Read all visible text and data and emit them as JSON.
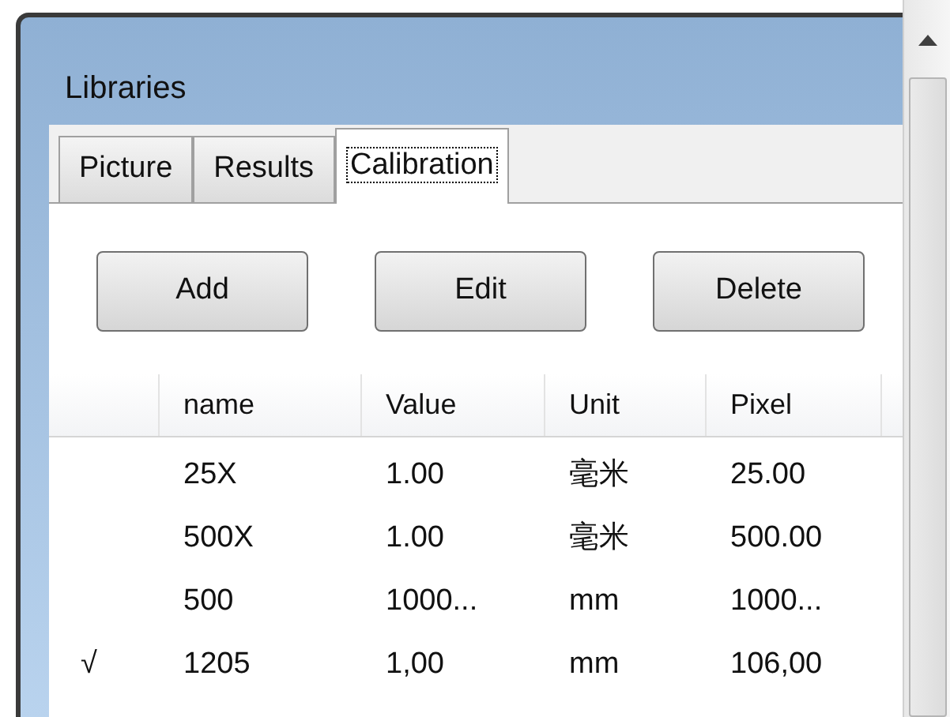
{
  "window": {
    "title": "Libraries"
  },
  "tabs": [
    {
      "label": "Picture",
      "selected": false
    },
    {
      "label": "Results",
      "selected": false
    },
    {
      "label": "Calibration",
      "selected": true
    }
  ],
  "buttons": [
    "Add",
    "Edit",
    "Delete"
  ],
  "table": {
    "columns": [
      "name",
      "Value",
      "Unit",
      "Pixel"
    ],
    "rows": [
      {
        "cells": [
          "25X",
          "1.00",
          "毫米",
          "25.00"
        ]
      },
      {
        "cells": [
          "500X",
          "1.00",
          "毫米",
          "500.00"
        ]
      },
      {
        "cells": [
          "500",
          "1000...",
          "mm",
          "1000..."
        ]
      },
      {
        "mark": "√",
        "cells": [
          "1205",
          "1,00",
          "mm",
          "106,00"
        ]
      }
    ]
  }
}
